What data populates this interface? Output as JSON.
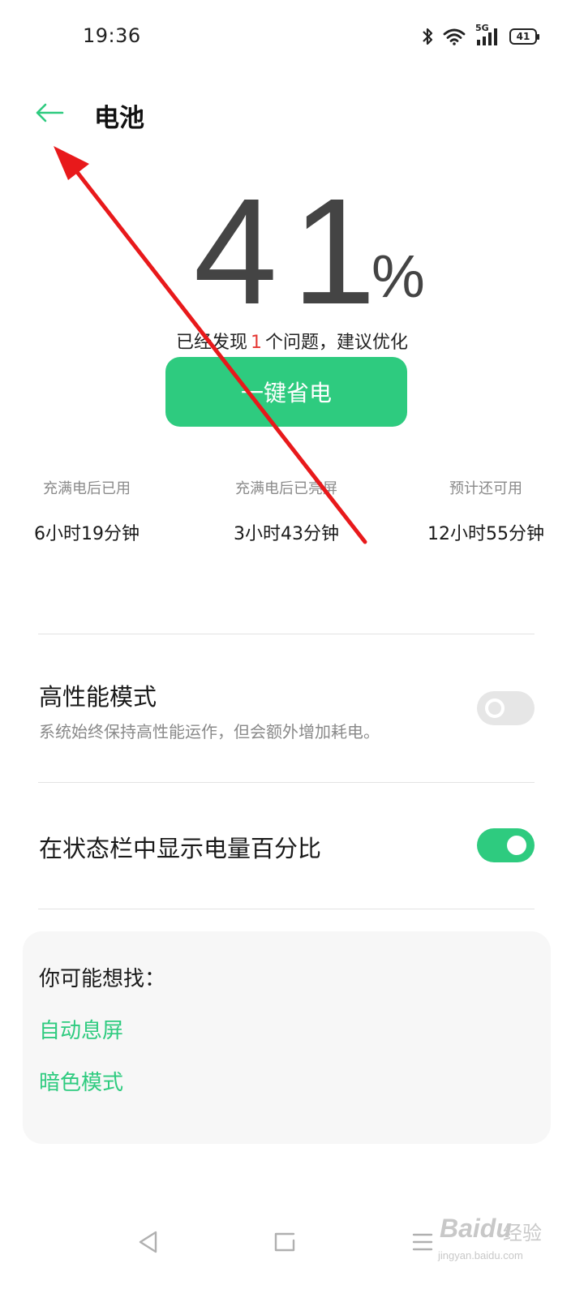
{
  "status_bar": {
    "time": "19:36",
    "network_label": "5G",
    "battery_text": "41",
    "icons": [
      "bluetooth-icon",
      "wifi-icon",
      "cellular-signal-icon",
      "battery-icon"
    ]
  },
  "header": {
    "title": "电池",
    "back_icon": "back-arrow-icon"
  },
  "battery": {
    "level": "41",
    "unit": "%",
    "issue_prefix": "已经发现",
    "issue_count": "1",
    "issue_suffix": "个问题，建议优化",
    "optimize_button": "一键省电"
  },
  "stats": [
    {
      "label": "充满电后已用",
      "value": "6小时19分钟"
    },
    {
      "label": "充满电后已亮屏",
      "value": "3小时43分钟"
    },
    {
      "label": "预计还可用",
      "value": "12小时55分钟"
    }
  ],
  "settings": {
    "performance_mode": {
      "title": "高性能模式",
      "description": "系统始终保持高性能运作，但会额外增加耗电。",
      "enabled": false
    },
    "show_percentage": {
      "title": "在状态栏中显示电量百分比",
      "enabled": true
    }
  },
  "suggestions": {
    "heading": "你可能想找：",
    "links": [
      "自动息屏",
      "暗色模式"
    ]
  },
  "navigation": {
    "buttons": [
      "back-triangle-icon",
      "home-icon",
      "recents-menu-icon"
    ]
  },
  "watermark": {
    "brand": "Baidu",
    "brand_cn": "经验",
    "url": "jingyan.baidu.com"
  },
  "colors": {
    "accent": "#2ecb7f",
    "issue_highlight": "#e53935",
    "annotation_arrow": "#e8191b"
  }
}
